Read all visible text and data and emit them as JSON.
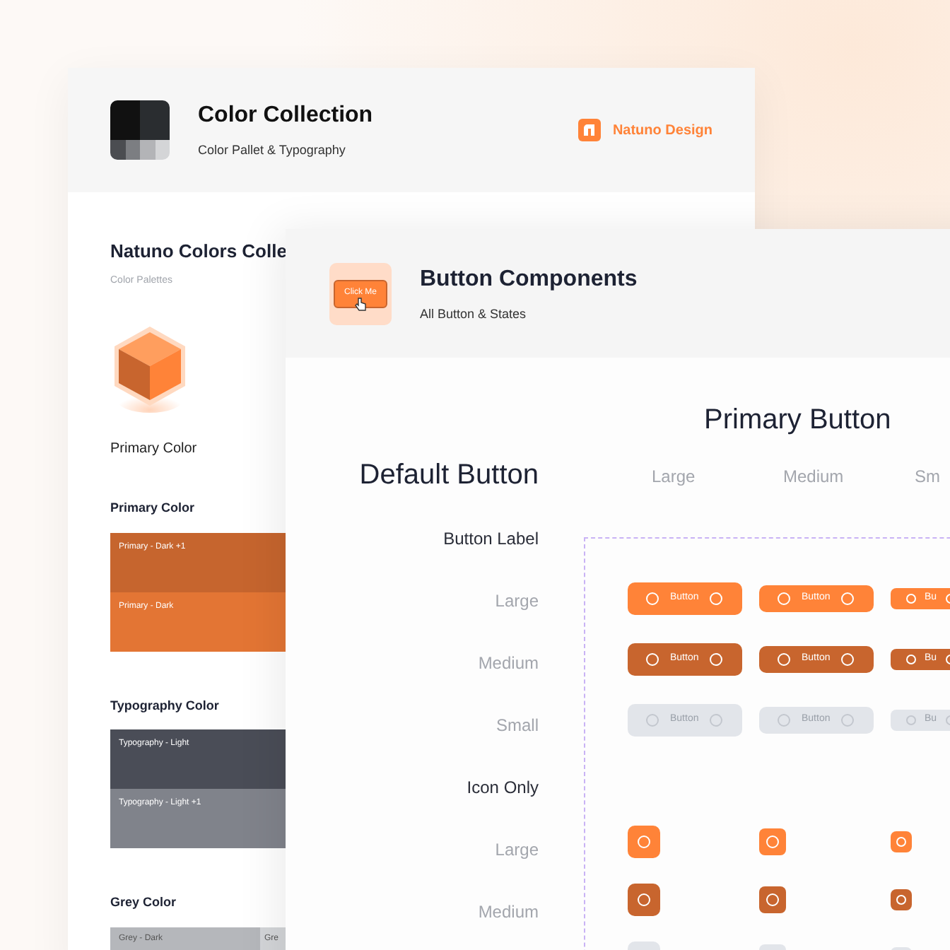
{
  "back_card": {
    "title": "Color Collection",
    "subtitle": "Color Pallet & Typography",
    "brand": "Natuno Design",
    "section_title": "Natuno Colors Colle",
    "section_subtitle": "Color Palettes",
    "hero_label": "Primary Color",
    "palettes": [
      {
        "title": "Primary Color",
        "side_by_side": false,
        "swatches": [
          {
            "label": "Primary - Dark +1",
            "color": "#c6652e"
          },
          {
            "label": "Primary - Dark",
            "color": "#e37534"
          }
        ]
      },
      {
        "title": "Typography Color",
        "side_by_side": false,
        "swatches": [
          {
            "label": "Typography - Light",
            "color": "#4a4d57"
          },
          {
            "label": "Typography - Light +1",
            "color": "#80838b"
          }
        ]
      },
      {
        "title": "Grey Color",
        "side_by_side": true,
        "swatches": [
          {
            "label": "Grey - Dark",
            "color": "#b5b7bb"
          },
          {
            "label": "Gre",
            "color": "#d3d5d8"
          }
        ]
      }
    ]
  },
  "front_card": {
    "title": "Button Components",
    "subtitle": "All Button & States",
    "preview_label": "Click Me",
    "section_title": "Primary Button",
    "group_title": "Default Button",
    "row_labels": [
      {
        "label": "Button Label",
        "kind": "group"
      },
      {
        "label": "Large",
        "kind": "size"
      },
      {
        "label": "Medium",
        "kind": "size"
      },
      {
        "label": "Small",
        "kind": "size"
      },
      {
        "label": "Icon Only",
        "kind": "group"
      },
      {
        "label": "Large",
        "kind": "size"
      },
      {
        "label": "Medium",
        "kind": "size"
      }
    ],
    "columns": [
      {
        "label": "Large"
      },
      {
        "label": "Medium"
      },
      {
        "label": "Sm"
      }
    ],
    "label_rows": [
      {
        "pressed": false,
        "disabled": false,
        "cells": [
          "Button",
          "Button",
          "Bu"
        ]
      },
      {
        "pressed": true,
        "disabled": false,
        "cells": [
          "Button",
          "Button",
          "Bu"
        ]
      },
      {
        "pressed": false,
        "disabled": true,
        "cells": [
          "Button",
          "Button",
          "Bu"
        ]
      }
    ],
    "icon_rows": [
      {
        "pressed": false,
        "disabled": false
      },
      {
        "pressed": true,
        "disabled": false
      },
      {
        "pressed": false,
        "disabled": true
      }
    ]
  }
}
